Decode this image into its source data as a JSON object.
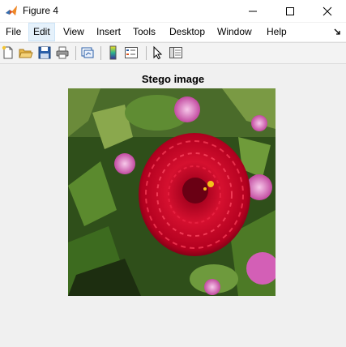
{
  "window": {
    "title": "Figure 4",
    "controls": [
      "minimize",
      "maximize",
      "close"
    ]
  },
  "menu": {
    "items": [
      "File",
      "Edit",
      "View",
      "Insert",
      "Tools",
      "Desktop",
      "Window",
      "Help"
    ],
    "active": "Edit"
  },
  "toolbar": {
    "icons": [
      "new-figure-icon",
      "open-file-icon",
      "save-figure-icon",
      "print-figure-icon",
      "link-plot-icon",
      "insert-colorbar-icon",
      "insert-legend-icon",
      "edit-plot-icon",
      "property-inspector-icon"
    ]
  },
  "figure": {
    "title": "Stego image"
  },
  "colors": {
    "background": "#f0f0f0",
    "flower": "#c8102e",
    "foliage": "#3d6b1f"
  }
}
